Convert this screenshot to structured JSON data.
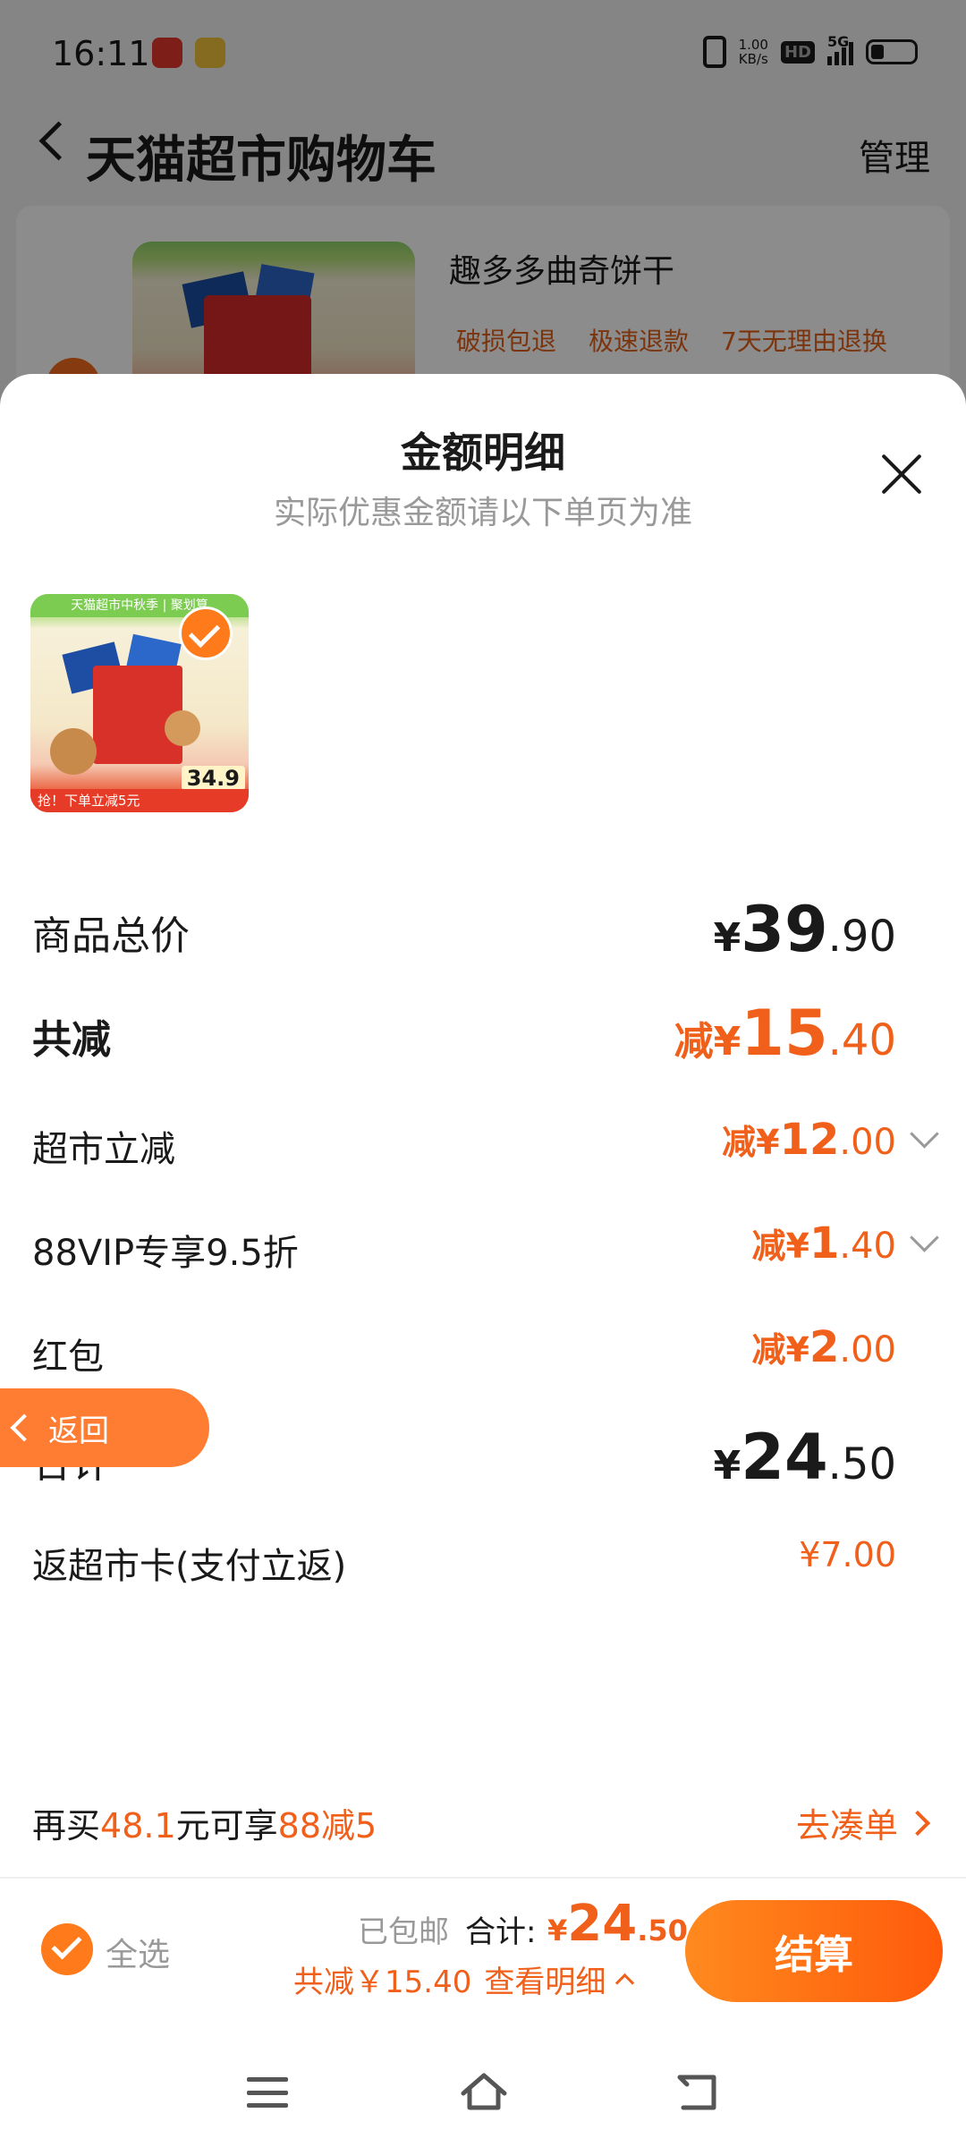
{
  "status_bar": {
    "time": "16:11",
    "net_speed_value": "1.00",
    "net_speed_unit": "KB/s",
    "hd": "HD",
    "network": "5G"
  },
  "header": {
    "title": "天猫超市购物车",
    "manage": "管理"
  },
  "background": {
    "product_title": "趣多多曲奇饼干",
    "tags": [
      "破损包退",
      "极速退款",
      "7天无理由退换"
    ]
  },
  "sheet": {
    "title": "金额明细",
    "subtitle": "实际优惠金额请以下单页为准",
    "product_image": {
      "banner": "天猫超市中秋季 | 聚划算",
      "promo": "抢！下单立减5元",
      "price": "34.9"
    },
    "rows": {
      "goods_total": {
        "label": "商品总价",
        "prefix": "¥",
        "int": "39",
        "dec": ".90"
      },
      "total_discount": {
        "label": "共减",
        "prefix": "减¥",
        "int": "15",
        "dec": ".40"
      },
      "market_discount": {
        "label": "超市立减",
        "prefix": "减¥",
        "int": "12",
        "dec": ".00"
      },
      "vip_discount": {
        "label": "88VIP专享9.5折",
        "prefix": "减¥",
        "int": "1",
        "dec": ".40"
      },
      "red_packet": {
        "label": "红包",
        "prefix": "减¥",
        "int": "2",
        "dec": ".00"
      },
      "subtotal": {
        "label": "合计",
        "prefix": "¥",
        "int": "24",
        "dec": ".50"
      },
      "card_rebate": {
        "label": "返超市卡(支付立返)",
        "value": "¥7.00"
      }
    },
    "back_pill": "返回"
  },
  "promo": {
    "part1": "再买",
    "amount": "48.1",
    "part2": "元可享",
    "offer": "88减5",
    "gather": "去凑单"
  },
  "bottom_bar": {
    "select_all": "全选",
    "shipping": "已包邮",
    "total_label": "合计:",
    "total_prefix": "¥",
    "total_int": "24",
    "total_dec": ".50",
    "saved": "共减￥15.40",
    "view_detail": "查看明细",
    "checkout": "结算"
  },
  "colors": {
    "accent": "#f0601a",
    "checkout_start": "#ff8a1f",
    "checkout_end": "#ff5a0a"
  }
}
